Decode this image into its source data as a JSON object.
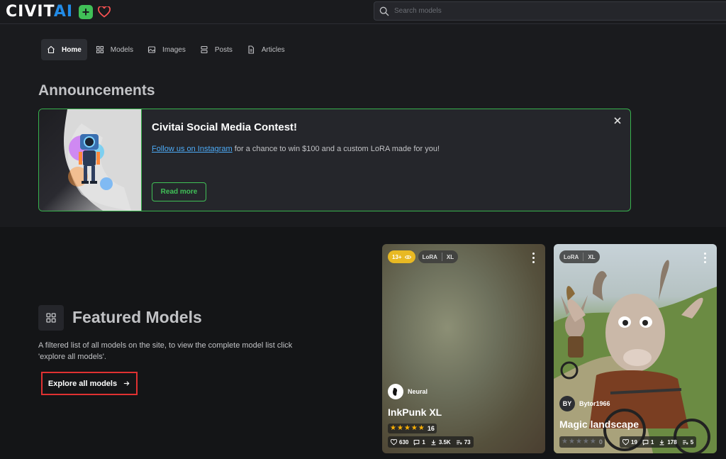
{
  "header": {
    "logo_main": "CIVIT",
    "logo_accent": "AI",
    "search_placeholder": "Search models"
  },
  "nav": {
    "items": [
      {
        "label": "Home",
        "icon": "home-icon",
        "active": true
      },
      {
        "label": "Models",
        "icon": "grid-icon",
        "active": false
      },
      {
        "label": "Images",
        "icon": "image-icon",
        "active": false
      },
      {
        "label": "Posts",
        "icon": "posts-icon",
        "active": false
      },
      {
        "label": "Articles",
        "icon": "article-icon",
        "active": false
      }
    ]
  },
  "announcements": {
    "title": "Announcements",
    "card": {
      "heading": "Civitai Social Media Contest!",
      "link_text": "Follow us on Instagram",
      "body_text": " for a chance to win $100 and a custom LoRA made for you!",
      "button_label": "Read more"
    }
  },
  "featured": {
    "title": "Featured Models",
    "description": "A filtered list of all models on the site, to view the complete model list click 'explore all models'.",
    "explore_label": "Explore all models"
  },
  "cards": [
    {
      "nsfw_badge": "13+",
      "type": "LoRA",
      "base": "XL",
      "creator": "Neural",
      "name": "InkPunk XL",
      "rating_stars": 5,
      "rating_count": "16",
      "likes": "630",
      "comments": "1",
      "downloads": "3.5K",
      "collections": "73"
    },
    {
      "type": "LoRA",
      "base": "XL",
      "creator_initials": "BY",
      "creator": "Bytor1966",
      "name": "Magic landscape",
      "rating_stars": 0,
      "rating_count": "0",
      "likes": "19",
      "comments": "1",
      "downloads": "178",
      "collections": "5"
    }
  ],
  "colors": {
    "accent_green": "#40c057",
    "link_blue": "#4dabf7",
    "highlight_red": "#e03131",
    "star_gold": "#fab005",
    "nsfw_yellow": "#e8b923"
  }
}
